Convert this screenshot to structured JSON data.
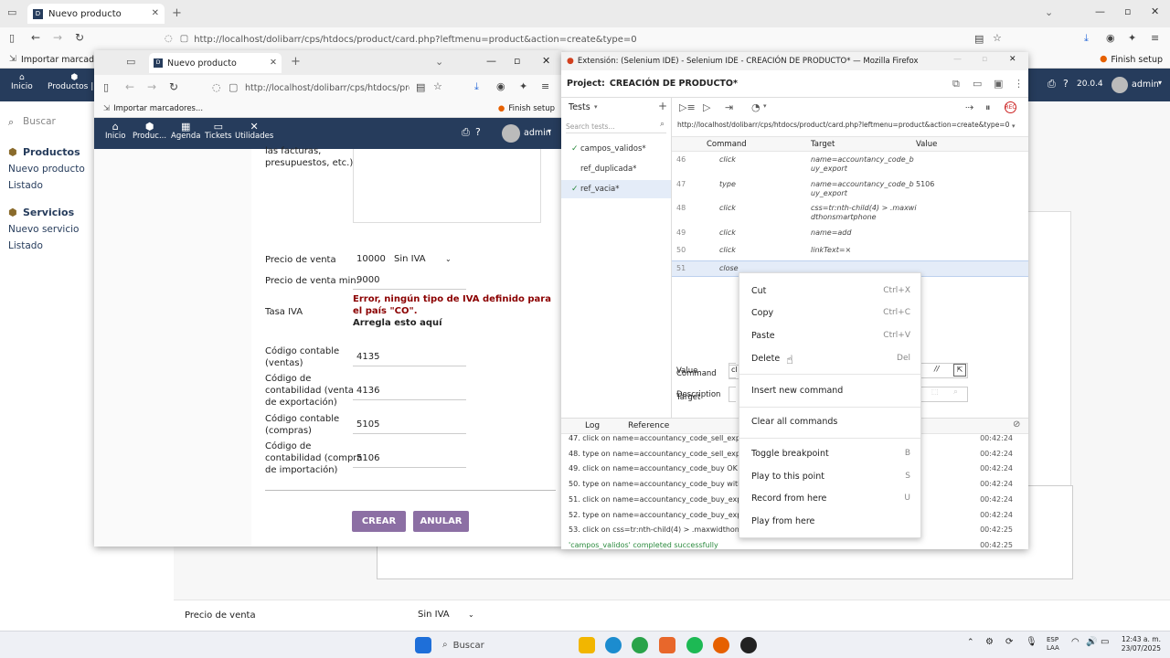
{
  "outer": {
    "tab_title": "Nuevo producto",
    "url": "http://localhost/dolibarr/cps/htdocs/product/card.php?leftmenu=product&action=create&type=0",
    "bookmark": "Importar marcadores...",
    "finish_setup": "Finish setup",
    "menu": [
      {
        "label": "Inicio"
      },
      {
        "label": "Productos | S"
      }
    ],
    "version": "20.0.4",
    "user": "admin",
    "search_placeholder": "Buscar",
    "sidebar": {
      "productos_h": "Productos",
      "nuevo_producto": "Nuevo producto",
      "listado1": "Listado",
      "servicios_h": "Servicios",
      "nuevo_servicio": "Nuevo servicio",
      "listado2": "Listado"
    },
    "bottom_label": "Precio de venta",
    "bottom_select": "Sin IVA"
  },
  "inner": {
    "tab_title": "Nuevo producto",
    "url": "http://localhost/dolibarr/cps/htdocs/product",
    "bookmark": "Importar marcadores...",
    "finish_setup": "Finish setup",
    "menu": [
      {
        "label": "Inicio"
      },
      {
        "label": "Produc..."
      },
      {
        "label": "Agenda"
      },
      {
        "label": "Tickets"
      },
      {
        "label": "Utilidades"
      }
    ],
    "user": "admin",
    "form": {
      "desc_tail": "las facturas,\npresupuestos, etc.)",
      "precio_venta_label": "Precio de venta",
      "precio_venta_value": "10000",
      "precio_venta_tax": "Sin IVA",
      "precio_min_label": "Precio de venta min.",
      "precio_min_value": "9000",
      "tasa_iva_label": "Tasa IVA",
      "tasa_iva_error": "Error, ningún tipo de IVA definido para el país \"CO\".",
      "tasa_iva_fix": "Arregla esto aquí",
      "cc_ventas_label": "Código contable\n(ventas)",
      "cc_ventas_value": "4135",
      "cc_export_label": "Código de\ncontabilidad (venta\nde exportación)",
      "cc_export_value": "4136",
      "cc_compras_label": "Código contable\n(compras)",
      "cc_compras_value": "5105",
      "cc_import_label": "Código de\ncontabilidad (compra\nde importación)",
      "cc_import_value": "5106",
      "crear": "CREAR",
      "anular": "ANULAR"
    }
  },
  "selenium": {
    "window_title": "Extensión: (Selenium IDE) - Selenium IDE - CREACIÓN DE PRODUCTO* — Mozilla Firefox",
    "project_label": "Project:",
    "project_name": "CREACIÓN DE PRODUCTO*",
    "tests_label": "Tests",
    "search_placeholder": "Search tests...",
    "tests": [
      {
        "name": "campos_validos*",
        "check": "✓"
      },
      {
        "name": "ref_duplicada*",
        "check": ""
      },
      {
        "name": "ref_vacia*",
        "check": "✓"
      }
    ],
    "base_url": "http://localhost/dolibarr/cps/htdocs/product/card.php?leftmenu=product&action=create&type=0",
    "col_command": "Command",
    "col_target": "Target",
    "col_value": "Value",
    "commands": [
      {
        "n": "46",
        "cmd": "click",
        "target": "name=accountancy_code_b\nuy_export",
        "value": ""
      },
      {
        "n": "47",
        "cmd": "type",
        "target": "name=accountancy_code_b\nuy_export",
        "value": "5106"
      },
      {
        "n": "48",
        "cmd": "click",
        "target": "css=tr:nth-child(4) > .maxwi\ndthonsmartphone",
        "value": ""
      },
      {
        "n": "49",
        "cmd": "click",
        "target": "name=add",
        "value": ""
      },
      {
        "n": "50",
        "cmd": "click",
        "target": "linkText=×",
        "value": ""
      },
      {
        "n": "51",
        "cmd": "close",
        "target": "",
        "value": ""
      }
    ],
    "editor": {
      "command": "Command",
      "target": "Target",
      "value": "Value",
      "description": "Description",
      "cmd_prefix": "cl"
    },
    "log_tab": "Log",
    "reference_tab": "Reference",
    "log": [
      {
        "text": "47. click on name=accountancy_code_sell_export OK",
        "time": "00:42:24"
      },
      {
        "text": "48. type on name=accountancy_code_sell_export w",
        "time": "00:42:24"
      },
      {
        "text": "49. click on name=accountancy_code_buy OK",
        "time": "00:42:24"
      },
      {
        "text": "50. type on name=accountancy_code_buy with valu",
        "time": "00:42:24"
      },
      {
        "text": "51. click on name=accountancy_code_buy_export O",
        "time": "00:42:24"
      },
      {
        "text": "52. type on name=accountancy_code_buy_export w",
        "time": "00:42:24"
      },
      {
        "text": "53. click on css=tr:nth-child(4) > .maxwidthonsmartp",
        "time": "00:42:25"
      },
      {
        "text": "'campos_validos' completed successfully",
        "time": "00:42:25"
      }
    ],
    "context_menu": [
      {
        "label": "Cut",
        "key": "Ctrl+X"
      },
      {
        "label": "Copy",
        "key": "Ctrl+C"
      },
      {
        "label": "Paste",
        "key": "Ctrl+V"
      },
      {
        "label": "Delete",
        "key": "Del"
      },
      {
        "label": "Insert new command",
        "key": ""
      },
      {
        "label": "Clear all commands",
        "key": ""
      },
      {
        "label": "Toggle breakpoint",
        "key": "B"
      },
      {
        "label": "Play to this point",
        "key": "S"
      },
      {
        "label": "Record from here",
        "key": "U"
      },
      {
        "label": "Play from here",
        "key": ""
      }
    ]
  },
  "taskbar": {
    "search": "Buscar",
    "lang1": "ESP",
    "lang2": "LAA",
    "time": "12:43 a. m.",
    "date": "23/07/2025"
  }
}
